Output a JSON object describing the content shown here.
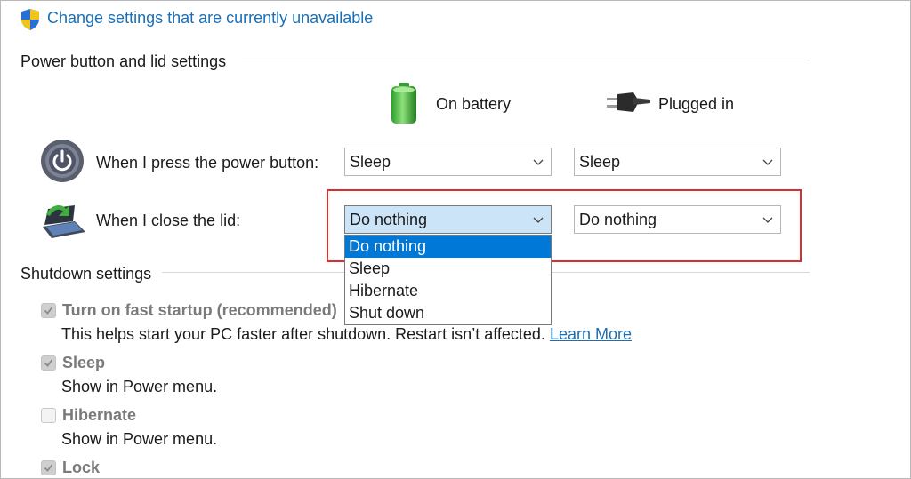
{
  "top_link": {
    "label": "Change settings that are currently unavailable",
    "icon": "uac-shield-icon"
  },
  "power_section": {
    "title": "Power button and lid settings",
    "columns": [
      {
        "label": "On battery",
        "icon": "battery-icon"
      },
      {
        "label": "Plugged in",
        "icon": "plug-icon"
      }
    ],
    "rows": [
      {
        "label": "When I press the power button:",
        "icon": "power-button-icon",
        "battery_value": "Sleep",
        "plugged_value": "Sleep"
      },
      {
        "label": "When I close the lid:",
        "icon": "laptop-lid-icon",
        "battery_value": "Do nothing",
        "plugged_value": "Do nothing"
      }
    ],
    "lid_dropdown_options": [
      "Do nothing",
      "Sleep",
      "Hibernate",
      "Shut down"
    ],
    "lid_dropdown_selected": "Do nothing"
  },
  "shutdown_section": {
    "title": "Shutdown settings",
    "items": [
      {
        "label": "Turn on fast startup (recommended)",
        "checked": true,
        "description": "This helps start your PC faster after shutdown. Restart isn’t affected.",
        "link": "Learn More"
      },
      {
        "label": "Sleep",
        "checked": true,
        "description": "Show in Power menu."
      },
      {
        "label": "Hibernate",
        "checked": false,
        "description": "Show in Power menu."
      },
      {
        "label": "Lock",
        "checked": true
      }
    ]
  },
  "colors": {
    "link": "#1a6fb5",
    "highlight": "#e02c2c",
    "selection": "#0078d7",
    "open_select": "#cce4f7"
  }
}
